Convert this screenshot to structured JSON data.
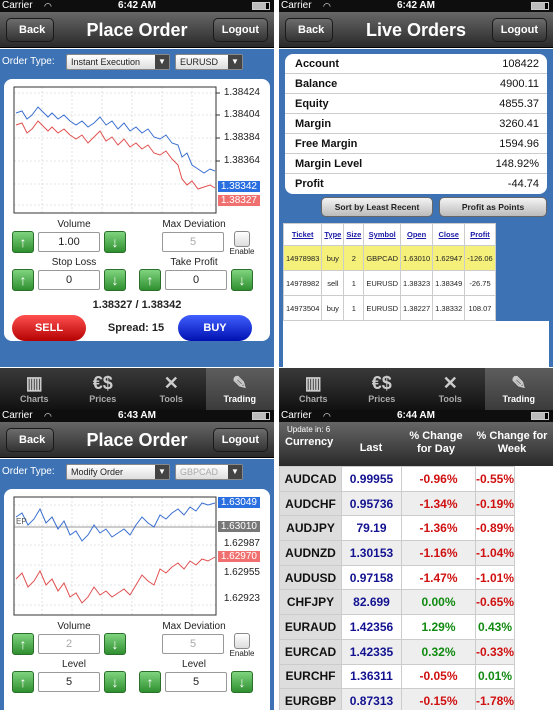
{
  "colors": {
    "accent_blue": "#3d73b5",
    "sell": "#d01010",
    "buy": "#0010b0",
    "highlight": "#f5f07a"
  },
  "p1": {
    "status": {
      "carrier": "Carrier",
      "time": "6:42 AM"
    },
    "nav": {
      "back": "Back",
      "title": "Place Order",
      "logout": "Logout"
    },
    "order_type_label": "Order Type:",
    "order_type": "Instant Execution",
    "symbol": "EURUSD",
    "chart_data": {
      "type": "line",
      "y_ticks": [
        "1.38424",
        "1.38404",
        "1.38384",
        "1.38364"
      ],
      "bid_label": "1.38342",
      "ask_label": "1.38327"
    },
    "volume_label": "Volume",
    "volume": "1.00",
    "max_dev_label": "Max Deviation",
    "max_dev": "5",
    "enable_label": "Enable",
    "stop_loss_label": "Stop Loss",
    "stop_loss": "0",
    "take_profit_label": "Take Profit",
    "take_profit": "0",
    "prices": "1.38327 / 1.38342",
    "sell": "SELL",
    "spread": "Spread: 15",
    "buy": "BUY",
    "tabs": [
      {
        "label": "Charts",
        "icon": "charts-icon"
      },
      {
        "label": "Prices",
        "icon": "prices-icon"
      },
      {
        "label": "Tools",
        "icon": "tools-icon"
      },
      {
        "label": "Trading",
        "icon": "trading-icon"
      }
    ]
  },
  "p2": {
    "status": {
      "carrier": "Carrier",
      "time": "6:42 AM"
    },
    "nav": {
      "back": "Back",
      "title": "Live Orders",
      "logout": "Logout"
    },
    "account": [
      {
        "k": "Account",
        "v": "108422"
      },
      {
        "k": "Balance",
        "v": "4900.11"
      },
      {
        "k": "Equity",
        "v": "4855.37"
      },
      {
        "k": "Margin",
        "v": "3260.41"
      },
      {
        "k": "Free Margin",
        "v": "1594.96"
      },
      {
        "k": "Margin Level",
        "v": "148.92%"
      },
      {
        "k": "Profit",
        "v": "-44.74"
      }
    ],
    "sort_btn": "Sort by Least Recent",
    "profit_btn": "Profit as Points",
    "columns": [
      "Ticket",
      "Type",
      "Size",
      "Symbol",
      "Open",
      "Close",
      "Profit"
    ],
    "orders": [
      [
        "14978983",
        "buy",
        "2",
        "GBPCAD",
        "1.63010",
        "1.62947",
        "-126.06"
      ],
      [
        "14978982",
        "sell",
        "1",
        "EURUSD",
        "1.38323",
        "1.38349",
        "-26.75"
      ],
      [
        "14973504",
        "buy",
        "1",
        "EURUSD",
        "1.38227",
        "1.38332",
        "108.07"
      ]
    ],
    "tabs": [
      "Charts",
      "Prices",
      "Tools",
      "Trading"
    ]
  },
  "p3": {
    "status": {
      "carrier": "Carrier",
      "time": "6:43 AM"
    },
    "nav": {
      "back": "Back",
      "title": "Place Order",
      "logout": "Logout"
    },
    "order_type_label": "Order Type:",
    "order_type": "Modify Order",
    "symbol": "GBPCAD",
    "chart_data": {
      "type": "line",
      "y_ticks": [
        "1.63049",
        "1.63010",
        "1.62987",
        "1.62970",
        "1.62955",
        "1.62923"
      ],
      "ep_label": "EP"
    },
    "volume_label": "Volume",
    "volume": "2",
    "max_dev_label": "Max Deviation",
    "max_dev": "5",
    "enable_label": "Enable",
    "level_label": "Level",
    "level1": "5",
    "level2": "5"
  },
  "p4": {
    "status": {
      "carrier": "Carrier",
      "time": "6:44 AM"
    },
    "update": "Update in: 6",
    "headers": [
      "Currency",
      "Last",
      "% Change for Day",
      "% Change for Week"
    ],
    "rows": [
      [
        "AUDCAD",
        "0.99955",
        "-0.96%",
        "-0.55%"
      ],
      [
        "AUDCHF",
        "0.95736",
        "-1.34%",
        "-0.19%"
      ],
      [
        "AUDJPY",
        "79.19",
        "-1.36%",
        "-0.89%"
      ],
      [
        "AUDNZD",
        "1.30153",
        "-1.16%",
        "-1.04%"
      ],
      [
        "AUDUSD",
        "0.97158",
        "-1.47%",
        "-1.01%"
      ],
      [
        "CHFJPY",
        "82.699",
        "0.00%",
        "-0.65%"
      ],
      [
        "EURAUD",
        "1.42356",
        "1.29%",
        "0.43%"
      ],
      [
        "EURCAD",
        "1.42335",
        "0.32%",
        "-0.33%"
      ],
      [
        "EURCHF",
        "1.36311",
        "-0.05%",
        "0.01%"
      ],
      [
        "EURGBP",
        "0.87313",
        "-0.15%",
        "-1.78%"
      ]
    ]
  }
}
